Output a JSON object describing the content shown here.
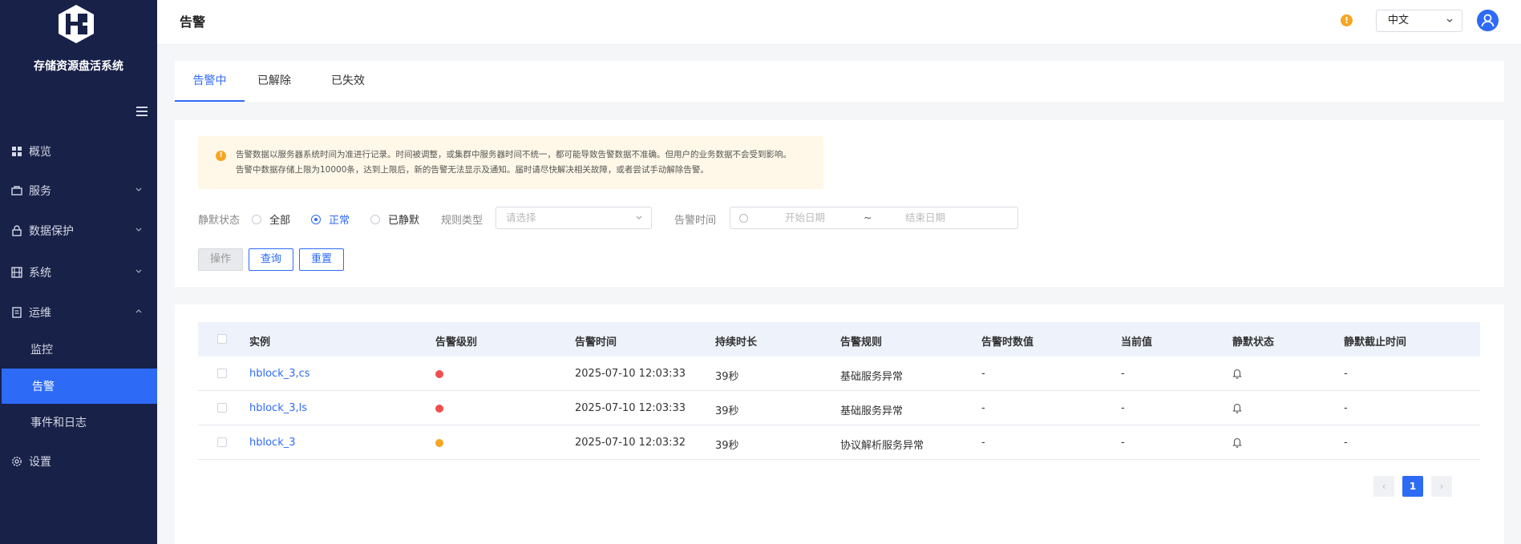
{
  "sidebar": {
    "app_title": "存储资源盘活系统",
    "items": [
      {
        "label": "概览",
        "icon": "dashboard-icon"
      },
      {
        "label": "服务",
        "icon": "box-icon"
      },
      {
        "label": "数据保护",
        "icon": "lock-icon"
      },
      {
        "label": "系统",
        "icon": "film-icon"
      },
      {
        "label": "运维",
        "icon": "document-icon"
      },
      {
        "label": "设置",
        "icon": "gear-icon"
      }
    ],
    "sub_items": [
      {
        "label": "监控"
      },
      {
        "label": "告警"
      },
      {
        "label": "事件和日志"
      }
    ]
  },
  "header": {
    "title": "告警",
    "warn_badge": "!",
    "language": "中文"
  },
  "tabs": [
    {
      "label": "告警中"
    },
    {
      "label": "已解除"
    },
    {
      "label": "已失效"
    }
  ],
  "notice": {
    "line1": "告警数据以服务器系统时间为准进行记录。时间被调整，或集群中服务器时间不统一，都可能导致告警数据不准确。但用户的业务数据不会受到影响。",
    "line2": "告警中数据存储上限为10000条，达到上限后，新的告警无法显示及通知。届时请尽快解决相关故障，或者尝试手动解除告警。"
  },
  "filters": {
    "silent_label": "静默状态",
    "silent_options": [
      "全部",
      "正常",
      "已静默"
    ],
    "rule_label": "规则类型",
    "rule_placeholder": "请选择",
    "time_label": "告警时间",
    "start_placeholder": "开始日期",
    "range_sep": "~",
    "end_placeholder": "结束日期"
  },
  "buttons": {
    "operate": "操作",
    "query": "查询",
    "reset": "重置"
  },
  "table": {
    "columns": [
      "实例",
      "告警级别",
      "告警时间",
      "持续时长",
      "告警规则",
      "告警时数值",
      "当前值",
      "静默状态",
      "静默截止时间"
    ],
    "rows": [
      {
        "instance": "hblock_3,cs",
        "level_color": "#f04f4f",
        "time": "2025-07-10 12:03:33",
        "duration": "39秒",
        "rule": "基础服务异常",
        "alarm_value": "-",
        "current_value": "-",
        "silence_end": "-"
      },
      {
        "instance": "hblock_3,ls",
        "level_color": "#f04f4f",
        "time": "2025-07-10 12:03:33",
        "duration": "39秒",
        "rule": "基础服务异常",
        "alarm_value": "-",
        "current_value": "-",
        "silence_end": "-"
      },
      {
        "instance": "hblock_3",
        "level_color": "#f6a623",
        "time": "2025-07-10 12:03:32",
        "duration": "39秒",
        "rule": "协议解析服务异常",
        "alarm_value": "-",
        "current_value": "-",
        "silence_end": "-"
      }
    ]
  },
  "pagination": {
    "prev": "‹",
    "current": "1",
    "next": "›"
  },
  "colors": {
    "accent": "#2d6bf6",
    "sidebar_bg": "#182148",
    "warning": "#f6a623",
    "critical": "#f04f4f"
  }
}
